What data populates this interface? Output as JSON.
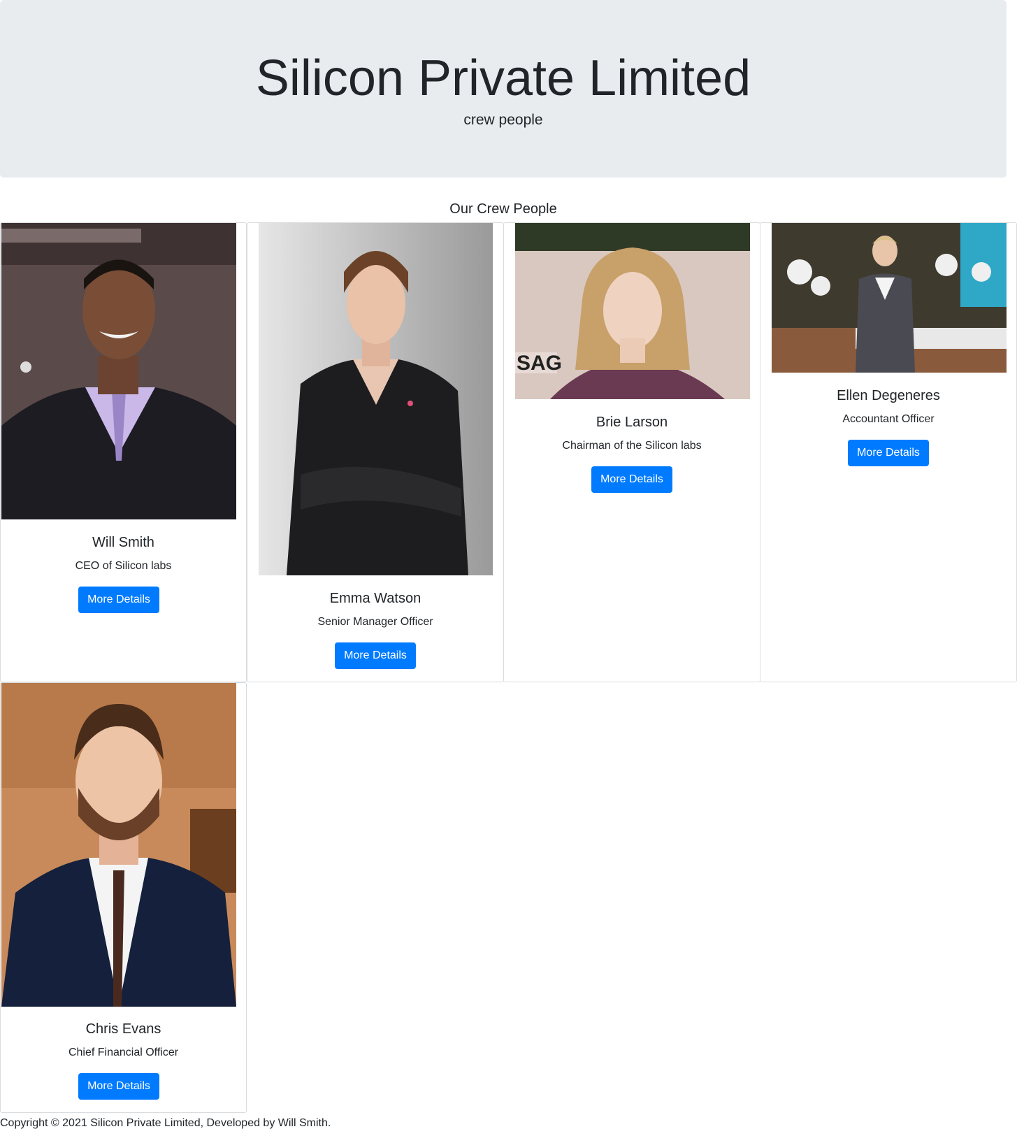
{
  "header": {
    "title": "Silicon Private Limited",
    "subtitle": "crew people"
  },
  "section": {
    "title": "Our Crew People"
  },
  "crew": [
    {
      "name": "Will Smith",
      "role": "CEO of Silicon labs",
      "button": "More Details",
      "photo": "will-smith-photo"
    },
    {
      "name": "Emma Watson",
      "role": "Senior Manager Officer",
      "button": "More Details",
      "photo": "emma-watson-photo"
    },
    {
      "name": "Brie Larson",
      "role": "Chairman of the Silicon labs",
      "button": "More Details",
      "photo": "brie-larson-photo"
    },
    {
      "name": "Ellen Degeneres",
      "role": "Accountant Officer",
      "button": "More Details",
      "photo": "ellen-degeneres-photo"
    },
    {
      "name": "Chris Evans",
      "role": "Chief Financial Officer",
      "button": "More Details",
      "photo": "chris-evans-photo"
    }
  ],
  "footer": {
    "text": "Copyright © 2021 Silicon Private Limited, Developed by Will Smith."
  },
  "colors": {
    "jumbotron_bg": "#e9ecef",
    "button_bg": "#007bff",
    "button_text": "#ffffff",
    "text": "#212529"
  }
}
